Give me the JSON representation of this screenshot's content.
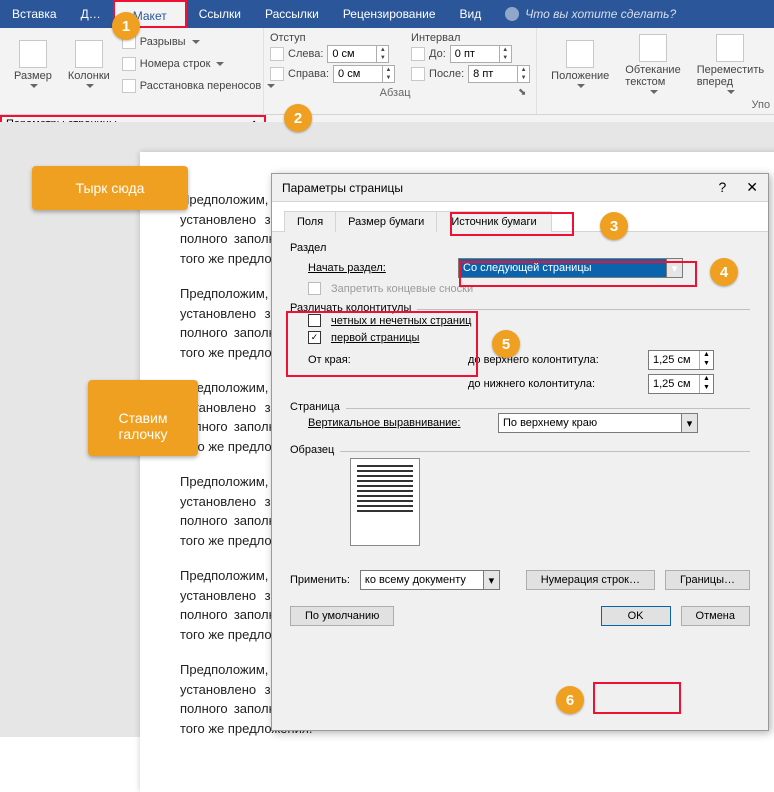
{
  "ribbon": {
    "tabs": [
      "Вставка",
      "Д…",
      "Макет",
      "Ссылки",
      "Рассылки",
      "Рецензирование",
      "Вид"
    ],
    "active_tab": "Макет",
    "tell_me": "Что вы хотите сделать?",
    "page_setup": {
      "size": "Размер",
      "columns": "Колонки",
      "breaks": "Разрывы",
      "line_numbers": "Номера строк",
      "hyphenation": "Расстановка переносов",
      "group_title": "Параметры страницы"
    },
    "paragraph": {
      "indent_title": "Отступ",
      "left": "Слева:",
      "right": "Справа:",
      "left_val": "0 см",
      "right_val": "0 см",
      "spacing_title": "Интервал",
      "before": "До:",
      "after": "После:",
      "before_val": "0 пт",
      "after_val": "8 пт",
      "group_title": "Абзац"
    },
    "arrange": {
      "position": "Положение",
      "wrap": "Обтекание текстом",
      "forward": "Переместить вперед",
      "group_title": "Упо"
    }
  },
  "callouts": {
    "c1_num": "1",
    "c2_num": "2",
    "c3_num": "3",
    "c4_num": "4",
    "c5_num": "5",
    "c6_num": "6",
    "tyrk": "Тырк сюда",
    "stavim": "Ставим\nгалочку"
  },
  "doc_para": "Предположим, в тексте документа имеется блок для текста.  Вокруг блока обтекание установлено заранее. Допустим, информация будет постоянной. А сейчас для более полного заполнения блока текстовой инфор мацией будет выполняться запись одного и того же предложения.",
  "dialog": {
    "title": "Параметры страницы",
    "tabs": {
      "fields": "Поля",
      "paper": "Размер бумаги",
      "source": "Источник бумаги"
    },
    "section": "Раздел",
    "start_section": "Начать раздел:",
    "start_section_val": "Со следующей страницы",
    "suppress_endnotes": "Запретить концевые сноски",
    "distinguish": "Различать колонтитулы",
    "odd_even": "четных и нечетных страниц",
    "first_page": "первой страницы",
    "from_edge": "От края:",
    "to_header": "до верхнего колонтитула:",
    "to_footer": "до нижнего колонтитула:",
    "header_val": "1,25 см",
    "footer_val": "1,25 см",
    "page": "Страница",
    "valign": "Вертикальное выравнивание:",
    "valign_val": "По верхнему краю",
    "sample": "Образец",
    "apply": "Применить:",
    "apply_val": "ко всему документу",
    "line_numbers_btn": "Нумерация строк…",
    "borders_btn": "Границы…",
    "default_btn": "По умолчанию",
    "ok": "OK",
    "cancel": "Отмена"
  }
}
